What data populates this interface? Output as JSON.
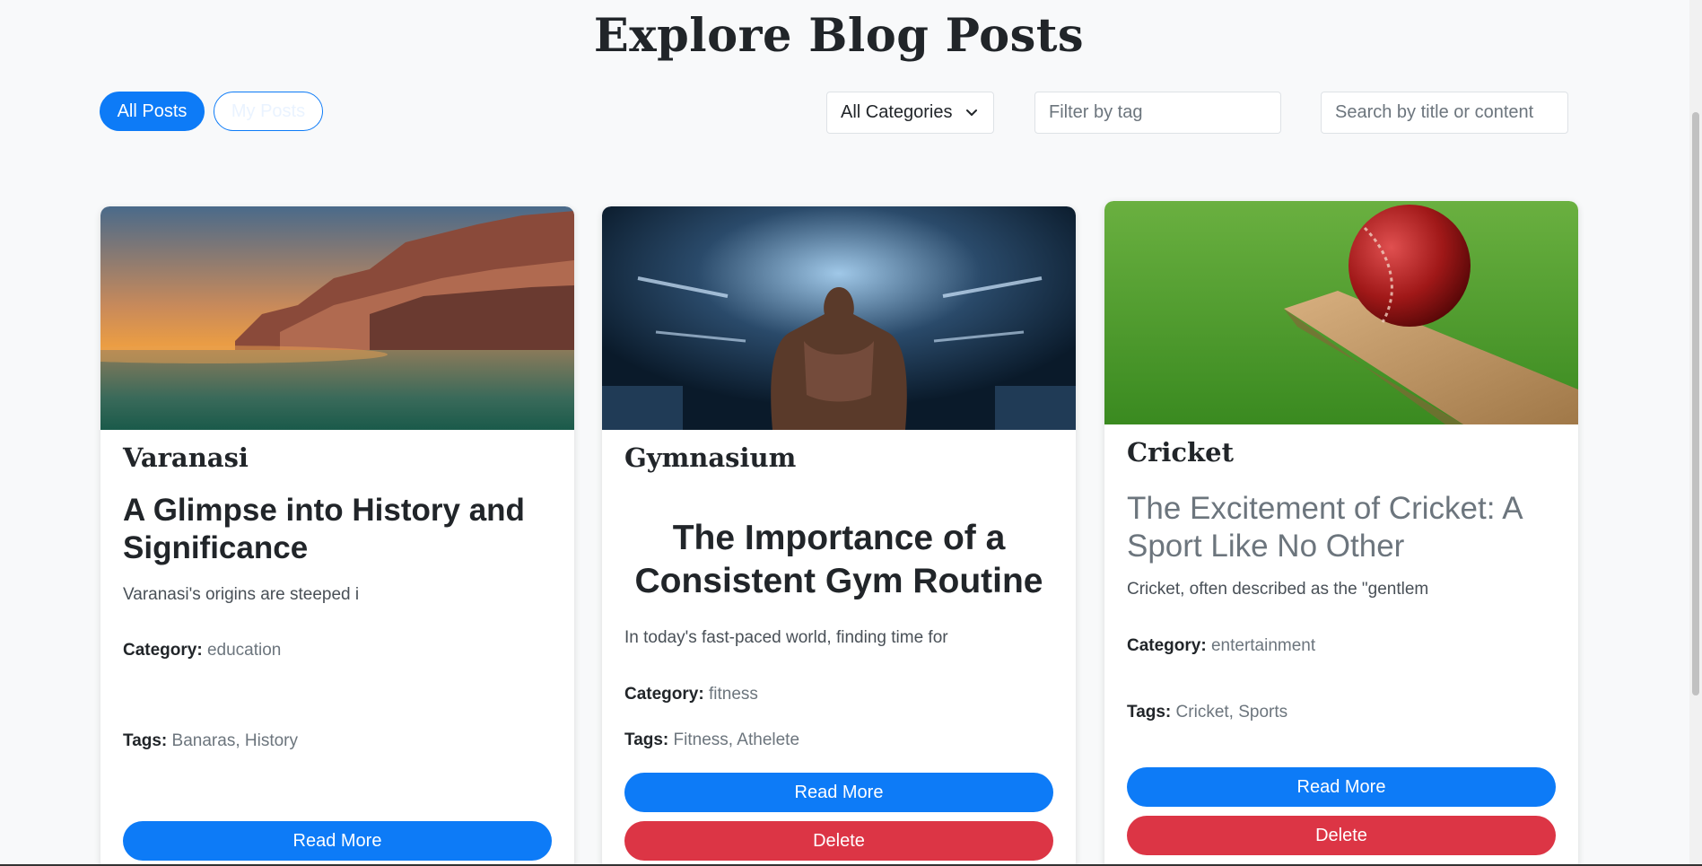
{
  "page": {
    "title": "Explore Blog Posts"
  },
  "filters": {
    "all_posts": "All Posts",
    "my_posts": "My Posts",
    "category_selected": "All Categories",
    "tag_placeholder": "Filter by tag",
    "search_placeholder": "Search by title or content"
  },
  "labels": {
    "category": "Category:",
    "tags": "Tags:",
    "read_more": "Read More",
    "delete": "Delete"
  },
  "posts": [
    {
      "name": "Varanasi",
      "title": "A Glimpse into History and Significance",
      "excerpt": "Varanasi's origins are steeped i",
      "category": "education",
      "tags": "Banaras, History",
      "image": "ghats-sunset-image"
    },
    {
      "name": "Gymnasium",
      "title": "The Importance of a Consistent Gym Routine",
      "excerpt": "In today's fast-paced world, finding time for",
      "category": "fitness",
      "tags": "Fitness, Athelete",
      "image": "gym-athlete-image"
    },
    {
      "name": "Cricket",
      "title": "The Excitement of Cricket: A Sport Like No Other",
      "excerpt": "Cricket, often described as the \"gentlem",
      "category": "entertainment",
      "tags": "Cricket, Sports",
      "image": "cricket-ball-bat-image"
    }
  ],
  "colors": {
    "primary": "#0d7bf7",
    "danger": "#dc3545",
    "background": "#f8f9fa"
  }
}
